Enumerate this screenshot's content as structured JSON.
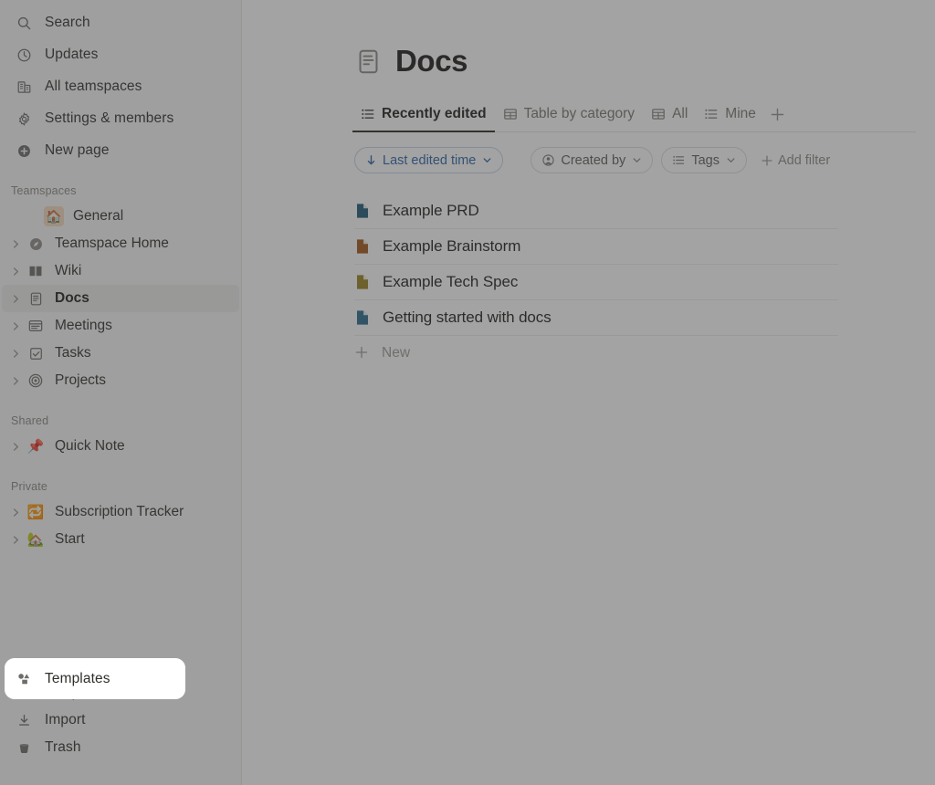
{
  "sidebar": {
    "top_items": [
      {
        "label": "Search",
        "icon": "search-icon"
      },
      {
        "label": "Updates",
        "icon": "clock-icon"
      },
      {
        "label": "All teamspaces",
        "icon": "building-icon"
      },
      {
        "label": "Settings & members",
        "icon": "gear-icon"
      },
      {
        "label": "New page",
        "icon": "plus-circle-icon"
      }
    ],
    "teamspaces_label": "Teamspaces",
    "teamspaces": [
      {
        "label": "General",
        "icon": "house-emoji",
        "emoji": "🏠",
        "has_chevron": false,
        "selected": false
      },
      {
        "label": "Teamspace Home",
        "icon": "compass-icon",
        "has_chevron": true,
        "selected": false
      },
      {
        "label": "Wiki",
        "icon": "book-icon",
        "has_chevron": true,
        "selected": false
      },
      {
        "label": "Docs",
        "icon": "document-icon",
        "has_chevron": true,
        "selected": true
      },
      {
        "label": "Meetings",
        "icon": "window-list-icon",
        "has_chevron": true,
        "selected": false
      },
      {
        "label": "Tasks",
        "icon": "checkbox-icon",
        "has_chevron": true,
        "selected": false
      },
      {
        "label": "Projects",
        "icon": "target-icon",
        "has_chevron": true,
        "selected": false
      }
    ],
    "shared_label": "Shared",
    "shared": [
      {
        "label": "Quick Note",
        "icon": "pushpin-emoji",
        "emoji": "📌",
        "has_chevron": true,
        "selected": false
      }
    ],
    "private_label": "Private",
    "private": [
      {
        "label": "Subscription Tracker",
        "icon": "repeat-emoji",
        "emoji": "🔁",
        "has_chevron": true,
        "selected": false
      },
      {
        "label": "Start",
        "icon": "house-with-garden-emoji",
        "emoji": "🏡",
        "has_chevron": true,
        "selected": false
      }
    ],
    "bottom_items": [
      {
        "label": "Templates",
        "icon": "shapes-icon",
        "highlighted": true
      },
      {
        "label": "Import",
        "icon": "download-icon",
        "highlighted": false
      },
      {
        "label": "Trash",
        "icon": "trash-icon",
        "highlighted": false
      }
    ]
  },
  "main": {
    "page_title": "Docs",
    "page_title_icon": "document-icon",
    "tabs": [
      {
        "label": "Recently edited",
        "icon": "list-icon",
        "active": true
      },
      {
        "label": "Table by category",
        "icon": "table-icon",
        "active": false
      },
      {
        "label": "All",
        "icon": "table-icon",
        "active": false
      },
      {
        "label": "Mine",
        "icon": "list-icon",
        "active": false
      }
    ],
    "tab_add_label": "+",
    "filters": {
      "sort_chip": {
        "label": "Last edited time",
        "icon": "arrow-down-icon",
        "caret": "chevron-down-icon"
      },
      "created_by_chip": {
        "label": "Created by",
        "icon": "person-circle-icon",
        "caret": "chevron-down-icon"
      },
      "tags_chip": {
        "label": "Tags",
        "icon": "list-icon",
        "caret": "chevron-down-icon"
      },
      "add_filter": {
        "label": "Add filter",
        "icon": "plus-icon"
      }
    },
    "documents": [
      {
        "name": "Example PRD",
        "icon": "page-icon",
        "color": "#1f5a78"
      },
      {
        "name": "Example Brainstorm",
        "icon": "page-icon",
        "color": "#a2581c"
      },
      {
        "name": "Example Tech Spec",
        "icon": "page-icon",
        "color": "#9a8320"
      },
      {
        "name": "Getting started with docs",
        "icon": "page-icon",
        "color": "#2a6b8e"
      }
    ],
    "new_row": {
      "label": "New",
      "icon": "plus-icon"
    }
  },
  "colors": {
    "accent_blue": "#2c65a8",
    "sidebar_bg": "#f8f8f7",
    "selected_row": "#ededeb",
    "overlay": "rgba(60,60,60,0.47)"
  }
}
